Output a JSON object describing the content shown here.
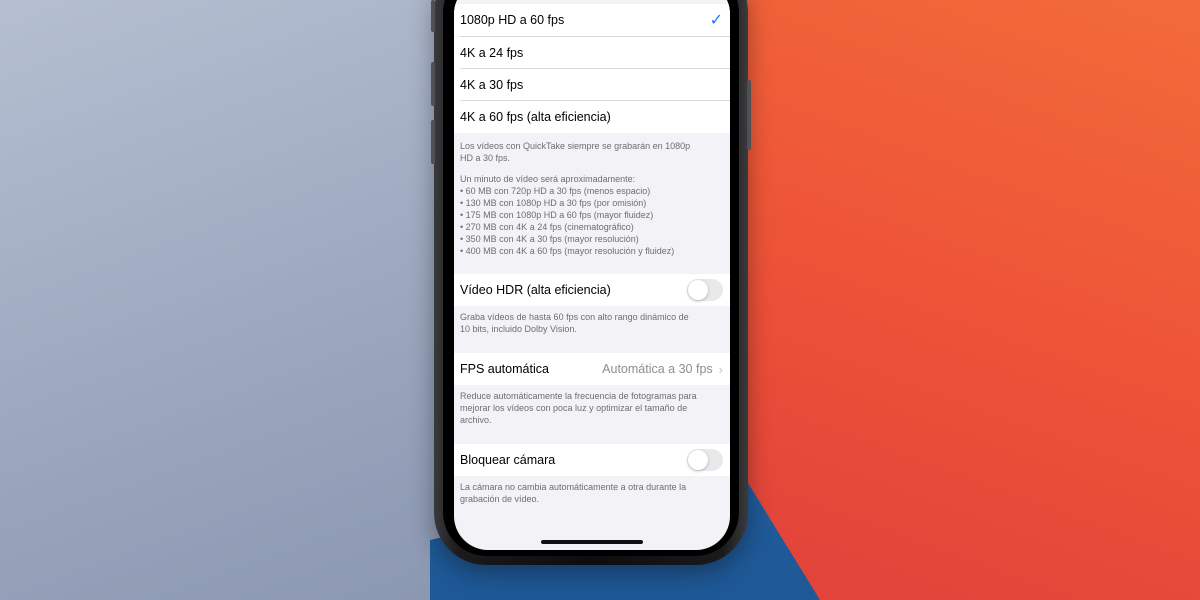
{
  "resolution_options": [
    {
      "label": "1080p HD a 60 fps",
      "selected": true
    },
    {
      "label": "4K a 24 fps",
      "selected": false
    },
    {
      "label": "4K a 30 fps",
      "selected": false
    },
    {
      "label": "4K a 60 fps (alta eficiencia)",
      "selected": false
    }
  ],
  "resolution_note": {
    "quicktake": [
      "Los vídeos con QuickTake siempre se grabarán en 1080p",
      "HD a 30 fps."
    ],
    "size_intro": "Un minuto de vídeo será aproximadamente:",
    "sizes": [
      "• 60 MB con 720p HD a 30 fps (menos espacio)",
      "• 130 MB con 1080p HD a 30 fps (por omisión)",
      "• 175 MB con 1080p HD a 60 fps (mayor fluidez)",
      "• 270 MB con 4K a 24 fps (cinematográfico)",
      "• 350 MB con 4K a 30 fps (mayor resolución)",
      "• 400 MB con 4K a 60 fps (mayor resolución y fluidez)"
    ]
  },
  "hdr": {
    "label": "Vídeo HDR (alta eficiencia)",
    "enabled": false,
    "note": [
      "Graba vídeos de hasta 60 fps con alto rango dinámico de",
      "10 bits, incluido Dolby Vision."
    ]
  },
  "auto_fps": {
    "label": "FPS automática",
    "value": "Automática a 30 fps",
    "chevron_icon": "chevron-right-icon",
    "note": [
      "Reduce automáticamente la frecuencia de fotogramas para",
      "mejorar los vídeos con poca luz y optimizar el tamaño de",
      "archivo."
    ]
  },
  "lock_camera": {
    "label": "Bloquear cámara",
    "enabled": false,
    "note": [
      "La cámara no cambia automáticamente a otra durante la",
      "grabación de vídeo."
    ]
  },
  "colors": {
    "accent": "#147efb",
    "toggle_off": "#e9e9eb",
    "grouped_background": "#f2f2f7"
  },
  "icons": {
    "checkmark": "checkmark-icon"
  }
}
